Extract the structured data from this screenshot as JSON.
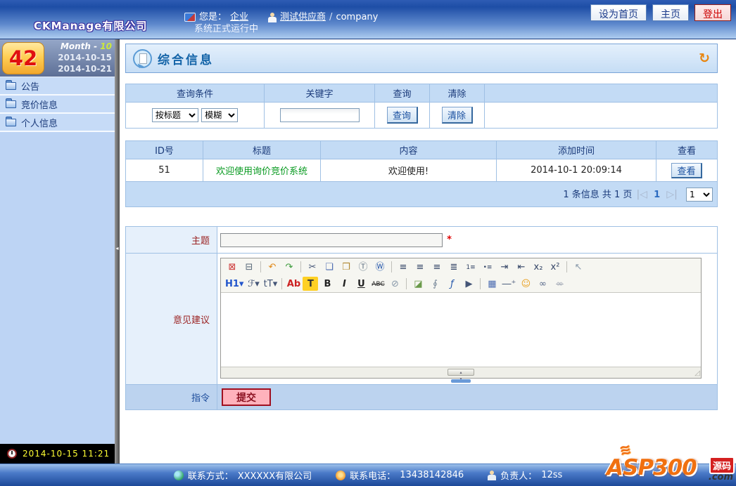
{
  "topbar": {
    "logo": "CKManage有限公司",
    "user_prefix": "您是：",
    "user_type": "企业",
    "supplier": "测试供应商",
    "separator": "/",
    "account": "company",
    "marquee": "系统正式运行中",
    "buttons": {
      "set_home": "设为首页",
      "home": "主页",
      "logout": "登出"
    }
  },
  "sidebar": {
    "calendar": {
      "week_number": "42",
      "month_label": "Month -",
      "month_value": "10",
      "date_from": "2014-10-15",
      "date_to": "2014-10-21"
    },
    "menu": [
      {
        "label": "公告"
      },
      {
        "label": "竞价信息"
      },
      {
        "label": "个人信息"
      }
    ],
    "status_time": "2014-10-15 11:21"
  },
  "main": {
    "title": "综合信息",
    "refresh_glyph": "↻",
    "query": {
      "headers": {
        "condition": "查询条件",
        "keyword": "关键字",
        "query": "查询",
        "clear": "清除"
      },
      "field_select": "按标题",
      "mode_select": "模糊",
      "keyword_value": "",
      "query_button": "查询",
      "clear_button": "清除"
    },
    "table": {
      "headers": {
        "id": "ID号",
        "title": "标题",
        "content": "内容",
        "time": "添加时间",
        "view": "查看"
      },
      "rows": [
        {
          "id": "51",
          "title": "欢迎使用询价竞价系统",
          "content": "欢迎使用!",
          "time": "2014-10-1 20:09:14",
          "view": "查看"
        }
      ],
      "pagination": {
        "info": "1 条信息  共 1 页",
        "first_glyph": "◁",
        "page": "1",
        "last_glyph": "▷",
        "page_select": "1"
      }
    },
    "form": {
      "subject_label": "主题",
      "required_mark": "*",
      "subject_value": "",
      "editor_label": "意见建议",
      "command_label": "指令",
      "submit_button": "提交",
      "toolbar_row1": [
        {
          "name": "fullscreen",
          "glyph": "⊠",
          "color": "#cc3333"
        },
        {
          "name": "print",
          "glyph": "⊟",
          "color": "#556677"
        },
        {
          "divider": true
        },
        {
          "name": "undo",
          "glyph": "↶",
          "color": "#e08818"
        },
        {
          "name": "redo",
          "glyph": "↷",
          "color": "#3a9a3a"
        },
        {
          "divider": true
        },
        {
          "name": "cut",
          "glyph": "✂",
          "color": "#445577"
        },
        {
          "name": "copy",
          "glyph": "❏",
          "color": "#4a6ab0"
        },
        {
          "name": "paste",
          "glyph": "❒",
          "color": "#b08830"
        },
        {
          "name": "paste-text",
          "glyph": "Ⓣ",
          "color": "#667788"
        },
        {
          "name": "paste-word",
          "glyph": "Ⓦ",
          "color": "#2255aa"
        },
        {
          "divider": true
        },
        {
          "name": "align-left",
          "glyph": "≡",
          "color": "#334466"
        },
        {
          "name": "align-center",
          "glyph": "≡",
          "color": "#334466"
        },
        {
          "name": "align-right",
          "glyph": "≡",
          "color": "#334466"
        },
        {
          "name": "justify",
          "glyph": "≣",
          "color": "#334466"
        },
        {
          "name": "ordered-list",
          "glyph": "1≡",
          "color": "#334466",
          "small": true
        },
        {
          "name": "unordered-list",
          "glyph": "•≡",
          "color": "#334466",
          "small": true
        },
        {
          "name": "indent",
          "glyph": "⇥",
          "color": "#334466"
        },
        {
          "name": "outdent",
          "glyph": "⇤",
          "color": "#334466"
        },
        {
          "name": "subscript",
          "glyph": "x₂",
          "color": "#334466"
        },
        {
          "name": "superscript",
          "glyph": "x²",
          "color": "#334466"
        },
        {
          "divider": true
        },
        {
          "name": "select-all",
          "glyph": "↖",
          "color": "#8899aa"
        }
      ],
      "toolbar_row2": [
        {
          "name": "heading",
          "glyph": "H1▾",
          "color": "#2255cc",
          "bold": true
        },
        {
          "name": "font-family",
          "glyph": "ℱ▾",
          "color": "#445577",
          "italic": true
        },
        {
          "name": "font-size",
          "glyph": "tT▾",
          "color": "#445577"
        },
        {
          "divider": true
        },
        {
          "name": "text-color",
          "glyph": "Ab",
          "color": "#cc2222",
          "bold": true
        },
        {
          "name": "highlight",
          "glyph": "T",
          "color": "#333333",
          "bg": "#ffd024",
          "bold": true
        },
        {
          "name": "bold",
          "glyph": "B",
          "color": "#222222",
          "bold": true
        },
        {
          "name": "italic",
          "glyph": "I",
          "color": "#222222",
          "italic": true,
          "bold": true
        },
        {
          "name": "underline",
          "glyph": "U",
          "color": "#222222",
          "underline": true,
          "bold": true
        },
        {
          "name": "strikethrough",
          "glyph": "ABC",
          "color": "#222222",
          "strike": true,
          "small": true
        },
        {
          "name": "remove-format",
          "glyph": "⊘",
          "color": "#8899aa"
        },
        {
          "divider": true
        },
        {
          "name": "image",
          "glyph": "◪",
          "color": "#6a9a4a"
        },
        {
          "name": "attachment",
          "glyph": "∮",
          "color": "#778899"
        },
        {
          "name": "flash",
          "glyph": "ƒ",
          "color": "#2255aa",
          "italic": true
        },
        {
          "name": "media",
          "glyph": "▶",
          "color": "#445577"
        },
        {
          "divider": true
        },
        {
          "name": "table",
          "glyph": "▦",
          "color": "#4a6ab0"
        },
        {
          "name": "horizontal-rule",
          "glyph": "―⁺",
          "color": "#445577"
        },
        {
          "name": "emoticon",
          "glyph": "☺",
          "color": "#e8a020"
        },
        {
          "name": "link",
          "glyph": "∞",
          "color": "#556688"
        },
        {
          "name": "unlink",
          "glyph": "∞",
          "color": "#aab0bb",
          "strike": true
        }
      ]
    }
  },
  "footer": {
    "contact_label": "联系方式：",
    "contact_value": "XXXXXX有限公司",
    "phone_label": "联系电话：",
    "phone_value": "13438142846",
    "manager_label": "负责人：",
    "manager_value": "12ss"
  },
  "watermark": {
    "flame": "≋",
    "brand": "ASP300",
    "badge": "源码",
    "domain": ".com"
  }
}
